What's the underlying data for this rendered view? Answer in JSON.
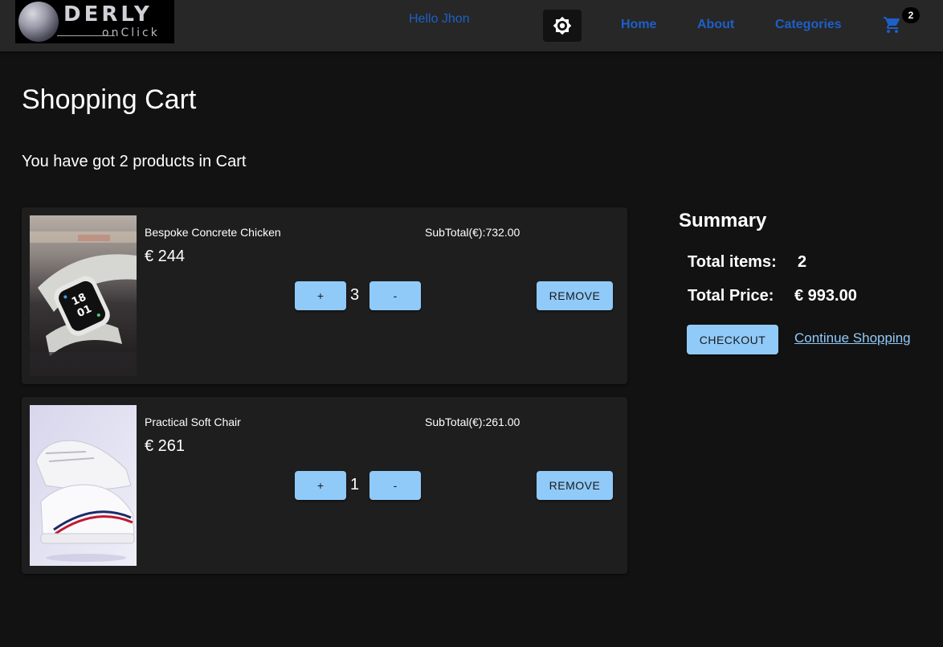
{
  "header": {
    "logo": {
      "word": "DERLY",
      "sub": "onClick"
    },
    "greeting": "Hello Jhon",
    "nav": {
      "home": "Home",
      "about": "About",
      "categories": "Categories"
    },
    "cart_badge": "2",
    "link_color": "#1e5fc7",
    "theme_icon": "brightness-icon",
    "cart_icon": "shopping-cart-icon"
  },
  "main": {
    "title": "Shopping Cart",
    "cart_count_text": "You have got 2 products in Cart"
  },
  "cart_items": [
    {
      "name": "Bespoke Concrete Chicken",
      "price": "€ 244",
      "subtotal": "SubTotal(€):732.00",
      "quantity": "3",
      "plus_label": "+",
      "minus_label": "-",
      "remove_label": "REMOVE",
      "image": "smartwatch-photo"
    },
    {
      "name": "Practical Soft Chair",
      "price": "€ 261",
      "subtotal": "SubTotal(€):261.00",
      "quantity": "1",
      "plus_label": "+",
      "minus_label": "-",
      "remove_label": "REMOVE",
      "image": "sneakers-photo"
    }
  ],
  "summary": {
    "title": "Summary",
    "total_items_label": "Total items:",
    "total_items_value": "2",
    "total_price_label": "Total Price:",
    "total_price_value": "€ 993.00",
    "checkout_label": "CHECKOUT",
    "continue_label": "Continue Shopping"
  },
  "colors": {
    "background": "#121212",
    "header": "#272727",
    "card": "#1e1e1e",
    "button": "#90caf9"
  }
}
